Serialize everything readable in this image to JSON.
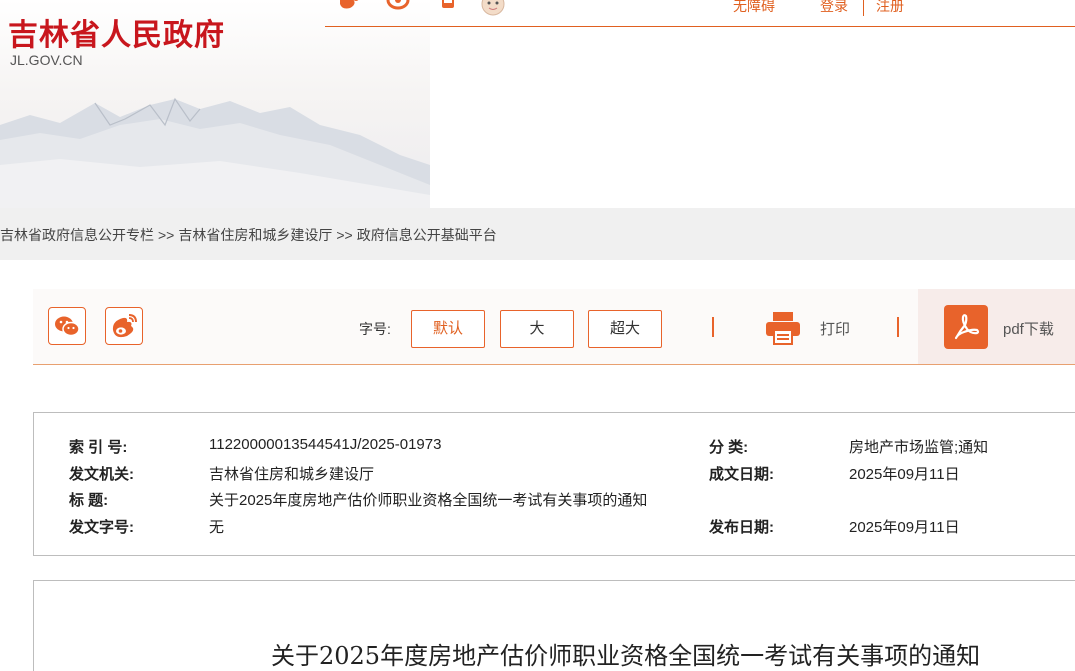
{
  "header": {
    "site_title": "吉林省人民政府",
    "site_domain": "JL.GOV.CN",
    "icons": [
      "weibo-icon",
      "wechat-icon",
      "mobile-icon",
      "avatar-icon"
    ],
    "accessibility_link": "无障碍",
    "login_link": "登录",
    "register_link": "注册"
  },
  "breadcrumb": {
    "items": [
      "吉林省政府信息公开专栏",
      "吉林省住房和城乡建设厅",
      "政府信息公开基础平台"
    ],
    "separator": ">>"
  },
  "toolbar": {
    "share_icons": [
      "wechat-icon",
      "weibo-icon"
    ],
    "font_label": "字号:",
    "font_default": "默认",
    "font_large": "大",
    "font_xlarge": "超大",
    "print_label": "打印",
    "pdf_label": "pdf下载"
  },
  "info": {
    "index_label": "索 引 号:",
    "index_value": "11220000013544541J/2025-01973",
    "category_label": "分 类:",
    "category_value": "房地产市场监管;通知",
    "issuer_label": "发文机关:",
    "issuer_value": "吉林省住房和城乡建设厅",
    "created_label": "成文日期:",
    "created_value": "2025年09月11日",
    "title_label": "标 题:",
    "title_value": "关于2025年度房地产估价师职业资格全国统一考试有关事项的通知",
    "docno_label": "发文字号:",
    "docno_value": "无",
    "published_label": "发布日期:",
    "published_value": "2025年09月11日"
  },
  "article": {
    "title": "关于2025年度房地产估价师职业资格全国统一考试有关事项的通知"
  },
  "colors": {
    "brand_red": "#c8161d",
    "accent_orange": "#e8632b"
  }
}
